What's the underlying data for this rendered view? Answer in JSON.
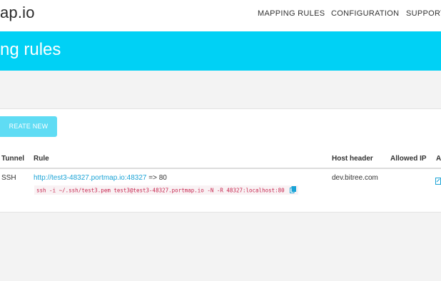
{
  "navbar": {
    "brand": "ap.io",
    "links": [
      "MAPPING RULES",
      "CONFIGURATION",
      "SUPPORT"
    ]
  },
  "hero": {
    "title": "ng rules"
  },
  "toolbar": {
    "create_label": "REATE NEW RULE"
  },
  "table": {
    "headers": [
      "Tunnel",
      "Rule",
      "Host header",
      "Allowed IP",
      "A"
    ],
    "rows": [
      {
        "tunnel": "SSH",
        "rule_link": "http://test3-48327.portmap.io:48327",
        "rule_suffix": " => 80",
        "command": "ssh -i ~/.ssh/test3.pem test3@test3-48327.portmap.io -N -R 48327:localhost:80",
        "host_header": "dev.bitree.com",
        "allowed_ip": ""
      }
    ]
  },
  "icons": {
    "copy": "copy-icon",
    "edit": "edit-icon"
  },
  "colors": {
    "accent": "#00d1f5",
    "button": "#5fdcf4",
    "link": "#1aa3d6",
    "code": "#c7254e"
  }
}
